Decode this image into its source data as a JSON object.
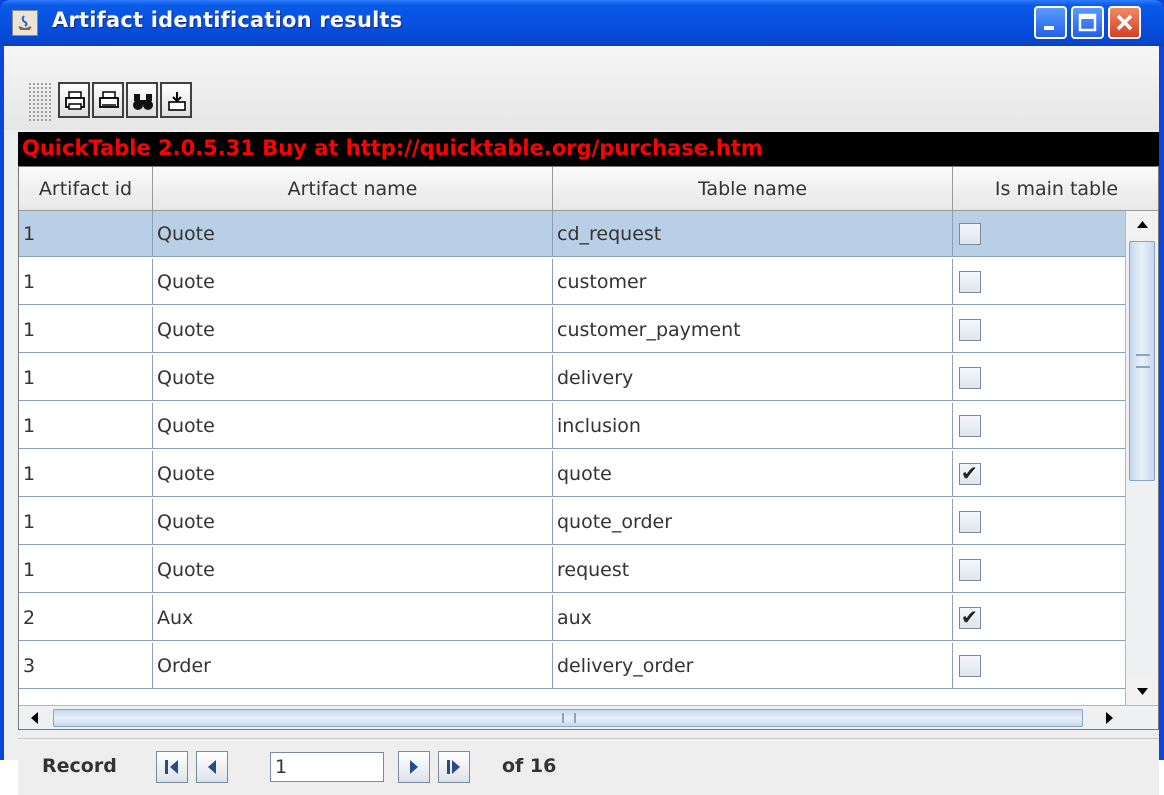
{
  "window": {
    "title": "Artifact identification results"
  },
  "toolbar": {
    "buttons": [
      {
        "icon": "print-icon"
      },
      {
        "icon": "print-preview-icon"
      },
      {
        "icon": "find-icon"
      },
      {
        "icon": "export-icon"
      }
    ]
  },
  "banner": {
    "text": "QuickTable 2.0.5.31 Buy at http://quicktable.org/purchase.htm",
    "color": "#ff0000"
  },
  "table": {
    "columns": [
      "Artifact id",
      "Artifact name",
      "Table name",
      "Is main table"
    ],
    "rows": [
      {
        "id": "1",
        "name": "Quote",
        "table": "cd_request",
        "main": false,
        "selected": true
      },
      {
        "id": "1",
        "name": "Quote",
        "table": "customer",
        "main": false
      },
      {
        "id": "1",
        "name": "Quote",
        "table": "customer_payment",
        "main": false
      },
      {
        "id": "1",
        "name": "Quote",
        "table": "delivery",
        "main": false
      },
      {
        "id": "1",
        "name": "Quote",
        "table": "inclusion",
        "main": false
      },
      {
        "id": "1",
        "name": "Quote",
        "table": "quote",
        "main": true
      },
      {
        "id": "1",
        "name": "Quote",
        "table": "quote_order",
        "main": false
      },
      {
        "id": "1",
        "name": "Quote",
        "table": "request",
        "main": false
      },
      {
        "id": "2",
        "name": "Aux",
        "table": "aux",
        "main": true
      },
      {
        "id": "3",
        "name": "Order",
        "table": "delivery_order",
        "main": false
      }
    ],
    "selection_color": "#b9cfe5"
  },
  "navigator": {
    "label": "Record",
    "current": "1",
    "total_text": "of 16"
  }
}
